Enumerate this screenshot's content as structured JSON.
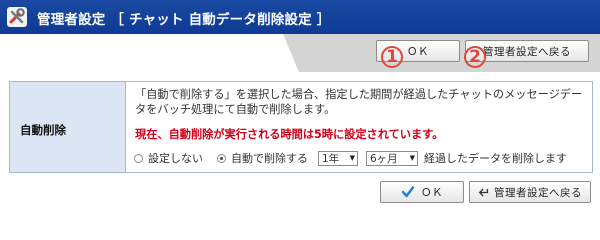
{
  "header": {
    "title": "管理者設定 ［ チャット 自動データ削除設定 ］",
    "icon": "tools-icon"
  },
  "top_buttons": {
    "ok_label": "ＯＫ",
    "back_label": "管理者設定へ戻る",
    "markers": [
      "1",
      "2"
    ]
  },
  "setting": {
    "label": "自動削除",
    "description": "「自動で削除する」を選択した場合、指定した期間が経過したチャットのメッセージデータをバッチ処理にて自動で削除します。",
    "warning": "現在、自動削除が実行される時間は5時に設定されています。",
    "option_none": "設定しない",
    "option_auto": "自動で削除する",
    "selected_option": "自動で削除する",
    "year_select": "1年",
    "month_select": "6ヶ月",
    "suffix": "経過したデータを削除します"
  },
  "bottom_buttons": {
    "ok_label": "ＯＫ",
    "back_label": "管理者設定へ戻る"
  },
  "colors": {
    "header_bg": "#0d3a93",
    "label_bg": "#dde6f4",
    "warning": "#d0021b",
    "marker": "#e0473a",
    "check": "#1e7fd6"
  }
}
